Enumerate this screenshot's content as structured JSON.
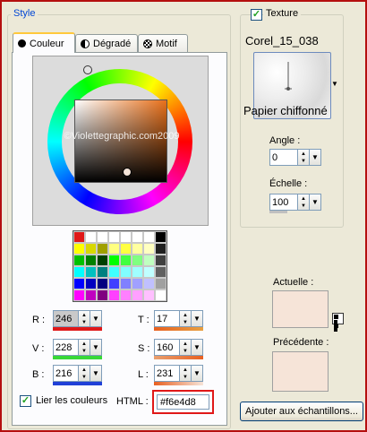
{
  "style_group": {
    "legend": "Style"
  },
  "tabs": [
    {
      "label": "Couleur",
      "icon": "circle-icon"
    },
    {
      "label": "Dégradé",
      "icon": "half-circle-icon"
    },
    {
      "label": "Motif",
      "icon": "pattern-icon"
    }
  ],
  "watermark": "©Violettegraphic.com2009",
  "palette_colors": [
    "#e01818",
    "#ffffff",
    "#ffffff",
    "#ffffff",
    "#ffffff",
    "#ffffff",
    "#ffffff",
    "#000000",
    "#ffff00",
    "#d8d800",
    "#a0a000",
    "#ffff80",
    "#ffff40",
    "#ffffa0",
    "#ffffc0",
    "#202020",
    "#00c000",
    "#008000",
    "#004000",
    "#00ff00",
    "#40ff40",
    "#80ff80",
    "#c0ffc0",
    "#404040",
    "#00ffff",
    "#00c0c0",
    "#008080",
    "#40ffff",
    "#80ffff",
    "#a0ffff",
    "#c0ffff",
    "#606060",
    "#0000ff",
    "#0000c0",
    "#000080",
    "#4040ff",
    "#8080ff",
    "#a0a0ff",
    "#c0c0ff",
    "#a0a0a0",
    "#ff00ff",
    "#c000c0",
    "#800080",
    "#ff40ff",
    "#ff80ff",
    "#ffa0ff",
    "#ffc0ff",
    "#ffffff"
  ],
  "rgb": {
    "r_label": "R :",
    "r_value": "246",
    "v_label": "V :",
    "v_value": "228",
    "b_label": "B :",
    "b_value": "216"
  },
  "hsl": {
    "t_label": "T :",
    "t_value": "17",
    "s_label": "S :",
    "s_value": "160",
    "l_label": "L :",
    "l_value": "231"
  },
  "lier": {
    "label": "Lier les couleurs",
    "checked": true
  },
  "html_field": {
    "label": "HTML :",
    "value": "#f6e4d8"
  },
  "texture": {
    "checkbox_label": "Texture",
    "checked": true,
    "name": "Corel_15_038",
    "preview_label": "Papier chiffonné",
    "angle_label": "Angle :",
    "angle_value": "0",
    "echelle_label": "Échelle :",
    "echelle_value": "100"
  },
  "actuelle_label": "Actuelle :",
  "precedente_label": "Précédente :",
  "add_button_label": "Ajouter aux échantillons...",
  "colors": {
    "current": "#f6e4d8",
    "previous": "#f6e4d8",
    "accent_red": "#e01818"
  }
}
